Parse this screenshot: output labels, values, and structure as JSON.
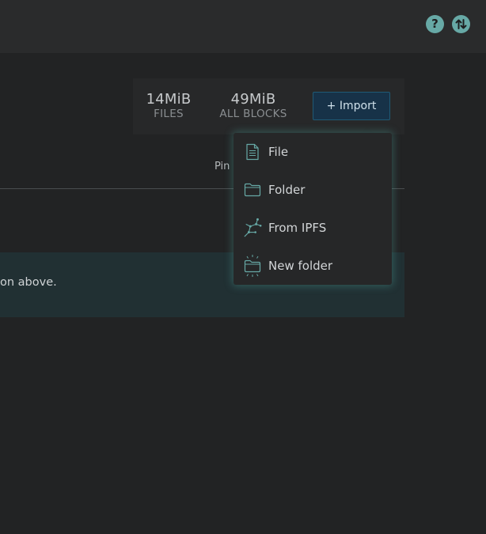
{
  "header": {
    "help_icon": "question-mark-icon",
    "help_glyph": "?",
    "transfer_icon": "transfer-arrows-icon"
  },
  "stats": {
    "files": {
      "value": "14MiB",
      "label": "FILES"
    },
    "all_blocks": {
      "value": "49MiB",
      "label": "ALL BLOCKS"
    }
  },
  "toolbar": {
    "import_label": "+ Import"
  },
  "table": {
    "pin_header": "Pin"
  },
  "notice": {
    "text": "on above."
  },
  "import_menu": {
    "items": [
      {
        "label": "File",
        "icon": "document-icon"
      },
      {
        "label": "Folder",
        "icon": "folder-icon"
      },
      {
        "label": "From IPFS",
        "icon": "ipfs-network-icon"
      },
      {
        "label": "New folder",
        "icon": "new-folder-icon"
      }
    ]
  },
  "colors": {
    "background": "#222324",
    "accent_teal": "#67a9a6",
    "import_button": "#173248",
    "menu_bg": "#262728"
  }
}
